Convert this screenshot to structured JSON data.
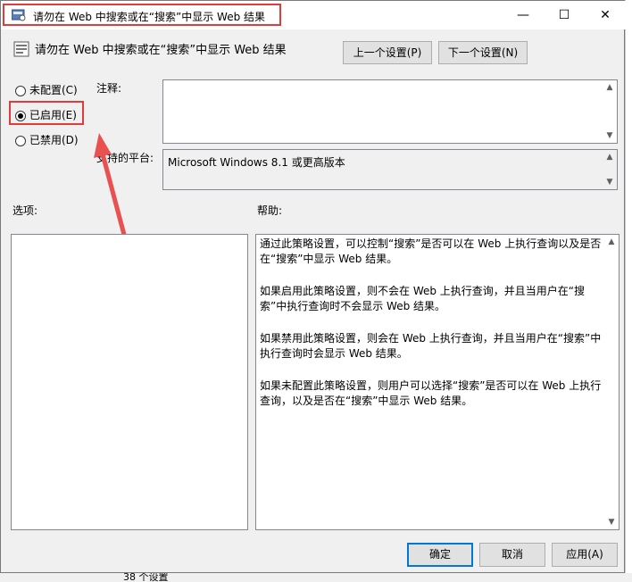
{
  "window": {
    "title": "请勿在 Web 中搜索或在“搜索”中显示 Web 结果",
    "minimize": "—",
    "maximize": "☐",
    "close": "✕"
  },
  "header": {
    "policy_name": "请勿在 Web 中搜索或在“搜索”中显示 Web 结果",
    "prev_button": "上一个设置(P)",
    "next_button": "下一个设置(N)"
  },
  "state_options": [
    {
      "label": "未配置(C)",
      "checked": false
    },
    {
      "label": "已启用(E)",
      "checked": true
    },
    {
      "label": "已禁用(D)",
      "checked": false
    }
  ],
  "comment": {
    "label": "注释:",
    "value": ""
  },
  "platform": {
    "label": "支持的平台:",
    "value": "Microsoft Windows 8.1 或更高版本"
  },
  "options": {
    "label": "选项:"
  },
  "help": {
    "label": "帮助:",
    "paragraphs": [
      "通过此策略设置，可以控制“搜索”是否可以在 Web 上执行查询以及是否在“搜索”中显示 Web 结果。",
      "如果启用此策略设置，则不会在 Web 上执行查询，并且当用户在“搜索”中执行查询时不会显示 Web 结果。",
      "如果禁用此策略设置，则会在 Web 上执行查询，并且当用户在“搜索”中执行查询时会显示 Web 结果。",
      "如果未配置此策略设置，则用户可以选择“搜索”是否可以在 Web 上执行查询，以及是否在“搜索”中显示 Web 结果。"
    ]
  },
  "footer": {
    "ok": "确定",
    "cancel": "取消",
    "apply": "应用(A)"
  },
  "background": {
    "status_text": "38 个设置"
  },
  "colors": {
    "annotation_red": "#e03c3c",
    "focus_blue": "#0078d7"
  }
}
